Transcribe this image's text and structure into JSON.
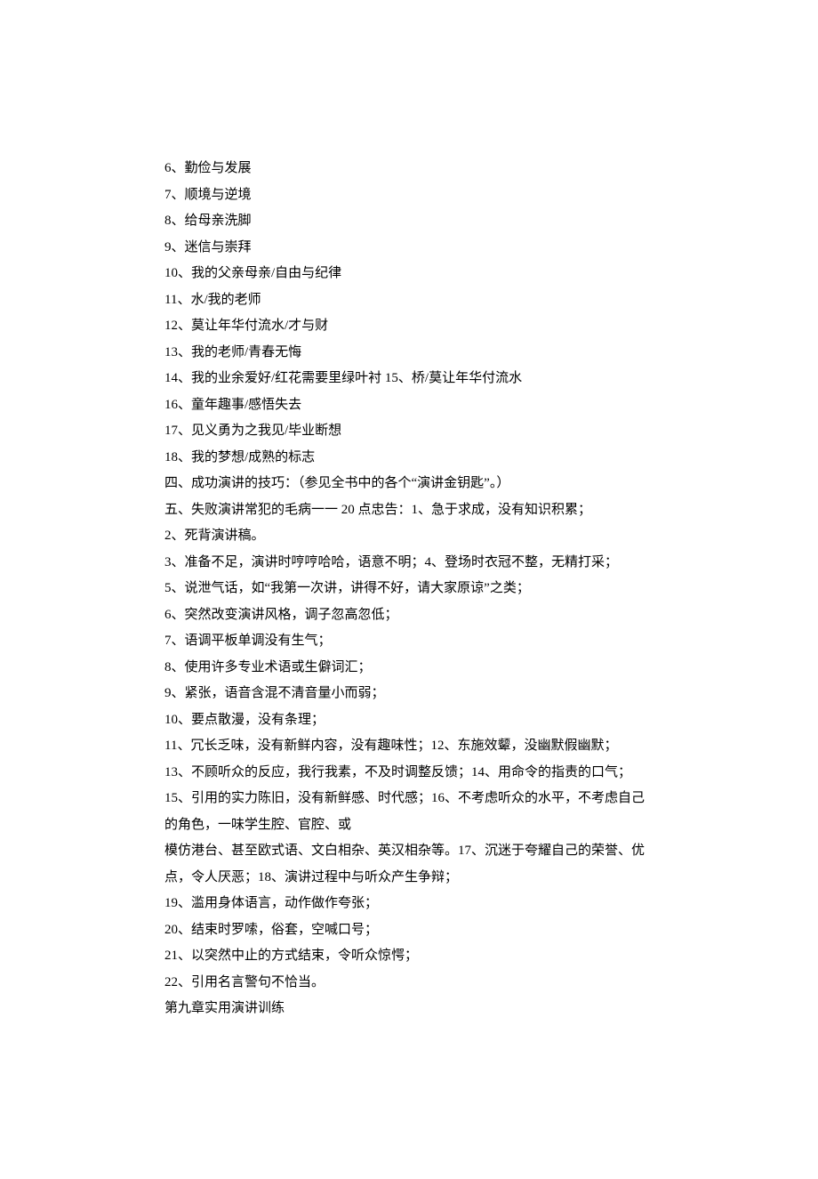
{
  "lines": [
    "6、勤俭与发展",
    "7、顺境与逆境",
    "8、给母亲洗脚",
    "9、迷信与崇拜",
    "10、我的父亲母亲/自由与纪律",
    "11、水/我的老师",
    "12、莫让年华付流水/才与财",
    "13、我的老师/青春无悔",
    "14、我的业余爱好/红花需要里绿叶衬 15、桥/莫让年华付流水",
    "16、童年趣事/感悟失去",
    "17、见义勇为之我见/毕业断想",
    "18、我的梦想/成熟的标志",
    "四、成功演讲的技巧：（参见全书中的各个“演讲金钥匙”。）",
    "五、失败演讲常犯的毛病一一 20 点忠告：1、急于求成，没有知识积累；",
    "2、死背演讲稿。",
    "3、准备不足，演讲时哼哼哈哈，语意不明；4、登场时衣冠不整，无精打采；",
    "5、说泄气话，如“我第一次讲，讲得不好，请大家原谅”之类；",
    "6、突然改变演讲风格，调子忽高忽低；",
    "7、语调平板单调没有生气；",
    "8、使用许多专业术语或生僻词汇；",
    "9、紧张，语音含混不清音量小而弱；",
    "10、要点散漫，没有条理；",
    "11、冗长乏味，没有新鲜内容，没有趣味性；12、东施效颦，没幽默假幽默；",
    "13、不顾听众的反应，我行我素，不及时调整反馈；14、用命令的指责的口气；",
    "15、引用的实力陈旧，没有新鲜感、时代感；16、不考虑听众的水平，不考虑自己的角色，一味学生腔、官腔、或",
    "模仿港台、甚至欧式语、文白相杂、英汉相杂等。17、沉迷于夸耀自己的荣誉、优点，令人厌恶；18、演讲过程中与听众产生争辩；",
    "19、滥用身体语言，动作做作夸张；",
    "20、结束时罗嗦，俗套，空喊口号；",
    "21、以突然中止的方式结束，令听众惊愕；",
    "22、引用名言警句不恰当。",
    "第九章实用演讲训练"
  ]
}
